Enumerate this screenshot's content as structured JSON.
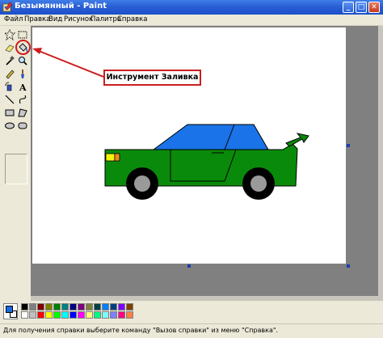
{
  "window": {
    "title": "Безымянный - Paint",
    "app_icon": "paint-icon",
    "controls": {
      "minimize": "_",
      "maximize": "□",
      "close": "✕"
    }
  },
  "menu": {
    "items": [
      "Файл",
      "Правка",
      "Вид",
      "Рисунок",
      "Палитра",
      "Справка"
    ]
  },
  "toolbox": {
    "tools": [
      {
        "name": "free-form-select-icon",
        "selected": false
      },
      {
        "name": "rect-select-icon",
        "selected": false
      },
      {
        "name": "eraser-icon",
        "selected": false
      },
      {
        "name": "fill-bucket-icon",
        "selected": true
      },
      {
        "name": "color-picker-icon",
        "selected": false
      },
      {
        "name": "magnifier-icon",
        "selected": false
      },
      {
        "name": "pencil-icon",
        "selected": false
      },
      {
        "name": "brush-icon",
        "selected": false
      },
      {
        "name": "airbrush-icon",
        "selected": false
      },
      {
        "name": "text-icon",
        "selected": false
      },
      {
        "name": "line-icon",
        "selected": false
      },
      {
        "name": "curve-icon",
        "selected": false
      },
      {
        "name": "rectangle-icon",
        "selected": false
      },
      {
        "name": "polygon-icon",
        "selected": false
      },
      {
        "name": "ellipse-icon",
        "selected": false
      },
      {
        "name": "rounded-rect-icon",
        "selected": false
      }
    ]
  },
  "annotation": {
    "callout_text": "Инструмент Заливка",
    "highlight_color": "#d41a1a"
  },
  "drawing": {
    "body_color": "#0a8a0a",
    "cabin_color": "#1a73e8",
    "wheel_color": "#000000",
    "hub_color": "#9a9a9a",
    "headlight_color": "#f5f50a",
    "taillight_color": "#f08a1a"
  },
  "palette": {
    "foreground": "#1a6ae0",
    "background": "#ffffff",
    "colors_top": [
      "#000000",
      "#808080",
      "#800000",
      "#808000",
      "#008000",
      "#008080",
      "#000080",
      "#800080",
      "#808040",
      "#004040",
      "#0080ff",
      "#004080",
      "#8000ff",
      "#804000"
    ],
    "colors_bottom": [
      "#ffffff",
      "#c0c0c0",
      "#ff0000",
      "#ffff00",
      "#00ff00",
      "#00ffff",
      "#0000ff",
      "#ff00ff",
      "#ffff80",
      "#00ff80",
      "#80ffff",
      "#8080ff",
      "#ff0080",
      "#ff8040"
    ]
  },
  "status": {
    "text": "Для получения справки выберите команду \"Вызов справки\" из меню \"Справка\"."
  }
}
